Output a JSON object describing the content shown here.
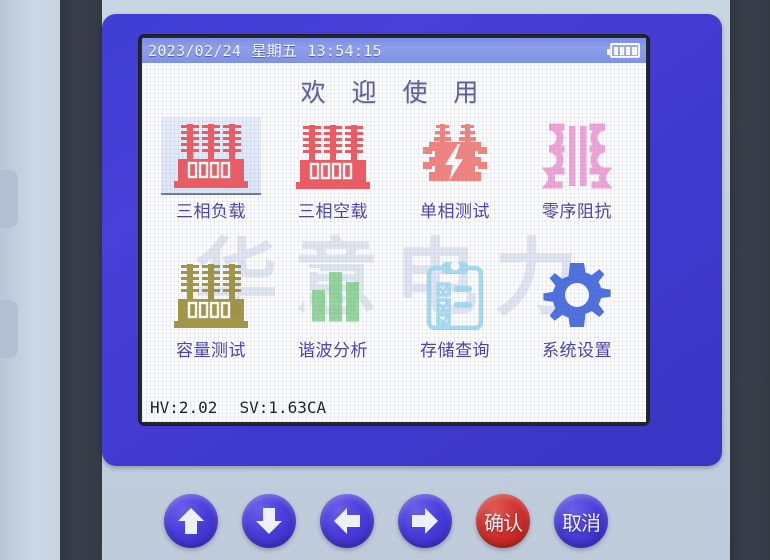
{
  "device": {
    "brand_watermark": "华意电力",
    "bezel_color": "#4039cf",
    "body_color": "#c6d1e0"
  },
  "statusbar": {
    "date": "2023/02/24",
    "weekday": "星期五",
    "time": "13:54:15",
    "battery_icon": "battery-icon",
    "battery_bars": 4,
    "background_color": "#8293ea"
  },
  "screen": {
    "title": "欢 迎 使 用",
    "title_color": "#5c5f95",
    "label_color": "#4b41a8"
  },
  "menu": {
    "items": [
      {
        "label": "三相负载",
        "icon": "transformer-icon",
        "color": "#f0595f",
        "selected": true
      },
      {
        "label": "三相空载",
        "icon": "transformer-icon",
        "color": "#f0595f",
        "selected": false
      },
      {
        "label": "单相测试",
        "icon": "single-phase-bolt-icon",
        "color": "#f4837c",
        "selected": false
      },
      {
        "label": "零序阻抗",
        "icon": "winding-coil-icon",
        "color": "#f3a3d8",
        "selected": false
      },
      {
        "label": "容量测试",
        "icon": "transformer-icon",
        "color": "#9c8b2e",
        "selected": false
      },
      {
        "label": "谐波分析",
        "icon": "bar-chart-icon",
        "color": "#82d28a",
        "selected": false
      },
      {
        "label": "存储查询",
        "icon": "clipboard-checklist-icon",
        "color": "#a5dcf2",
        "selected": false
      },
      {
        "label": "系统设置",
        "icon": "gear-icon",
        "color": "#4c6fe0",
        "selected": false
      }
    ]
  },
  "footer": {
    "hardware_version": "HV:2.02",
    "software_version": "SV:1.63CA"
  },
  "keypad": {
    "keys": [
      {
        "name": "up-arrow-key",
        "icon": "arrow-up-icon",
        "label": "",
        "color": "blue"
      },
      {
        "name": "down-arrow-key",
        "icon": "arrow-down-icon",
        "label": "",
        "color": "blue"
      },
      {
        "name": "left-arrow-key",
        "icon": "arrow-left-icon",
        "label": "",
        "color": "blue"
      },
      {
        "name": "right-arrow-key",
        "icon": "arrow-right-icon",
        "label": "",
        "color": "blue"
      },
      {
        "name": "confirm-key",
        "icon": "",
        "label": "确认",
        "color": "red"
      },
      {
        "name": "cancel-key",
        "icon": "",
        "label": "取消",
        "color": "blue"
      }
    ]
  }
}
